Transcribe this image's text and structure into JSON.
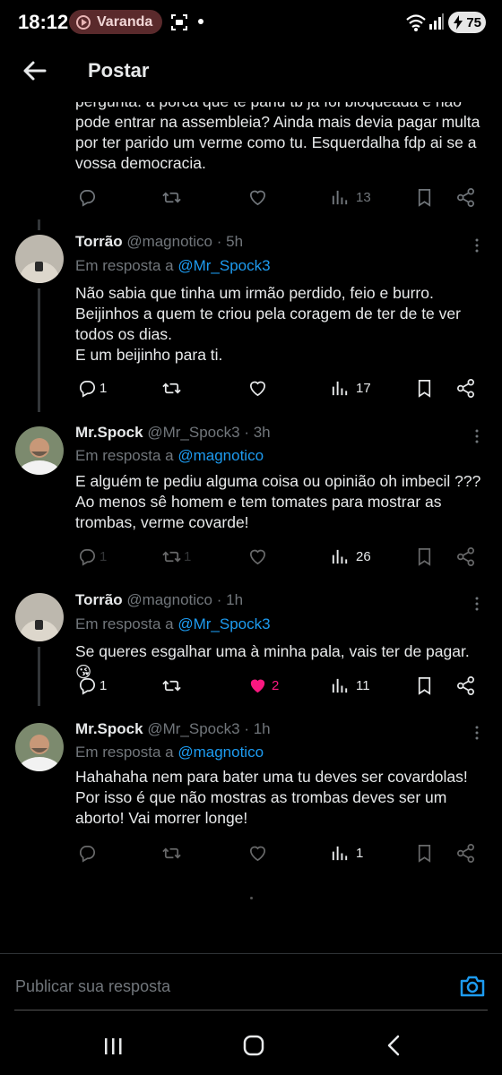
{
  "status_bar": {
    "time": "18:12",
    "media_label": "Varanda",
    "battery": "75"
  },
  "header": {
    "title": "Postar"
  },
  "clipped_tweet": {
    "text": "pergunta: a porca que te pariu tb já foi bloqueada e não pode entrar na assembleia? Ainda mais devia pagar multa por ter parido um verme como tu. Esquerdalha fdp ai se a vossa democracia.",
    "views": "13"
  },
  "tweets": [
    {
      "name": "Torrão",
      "handle": "@magnotico",
      "time": "· 5h",
      "reply_prefix": "Em resposta a",
      "reply_to": "@Mr_Spock3",
      "text": "Não sabia que tinha um irmão perdido, feio e burro.\nBeijinhos a quem te criou pela coragem de ter de te ver todos os dias.\nE um beijinho para ti.",
      "replies": "1",
      "reposts": "",
      "likes": "",
      "views": "17"
    },
    {
      "name": "Mr.Spock",
      "handle": "@Mr_Spock3",
      "time": "· 3h",
      "reply_prefix": "Em resposta a",
      "reply_to": "@magnotico",
      "text": "E alguém te pediu alguma coisa ou opinião  oh imbecil ???\nAo menos sê homem e tem tomates para mostrar as trombas, verme covarde!",
      "replies": "1",
      "reposts": "1",
      "likes": "",
      "views": "26"
    },
    {
      "name": "Torrão",
      "handle": "@magnotico",
      "time": "· 1h",
      "reply_prefix": "Em resposta a",
      "reply_to": "@Mr_Spock3",
      "text": "Se queres esgalhar uma à minha pala, vais ter de pagar. 😘",
      "replies": "1",
      "reposts": "",
      "likes": "2",
      "views": "11"
    },
    {
      "name": "Mr.Spock",
      "handle": "@Mr_Spock3",
      "time": "· 1h",
      "reply_prefix": "Em resposta a",
      "reply_to": "@magnotico",
      "text": "Hahahaha nem para bater uma tu deves ser covardolas!\nPor isso é que não mostras as trombas deves ser um aborto! Vai morrer longe!",
      "replies": "",
      "reposts": "",
      "likes": "",
      "views": "1"
    }
  ],
  "reply_bar": {
    "placeholder": "Publicar sua resposta"
  },
  "colors": {
    "background": "#000000",
    "link": "#1d9bf0",
    "like": "#f91880",
    "muted": "#71767b"
  }
}
